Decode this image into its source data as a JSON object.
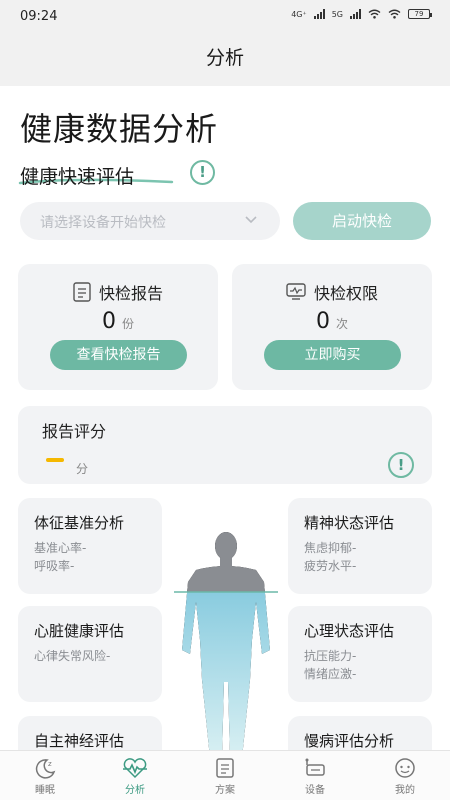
{
  "status_bar": {
    "time": "09:24",
    "net1": "4G⁺",
    "net2": "5G",
    "battery": "79"
  },
  "header": {
    "title": "分析"
  },
  "page": {
    "title": "健康数据分析"
  },
  "quick_eval": {
    "title": "健康快速评估",
    "select_placeholder": "请选择设备开始快检",
    "start_label": "启动快检"
  },
  "cards": {
    "report": {
      "title": "快检报告",
      "value": "0",
      "unit": "份",
      "button": "查看快检报告"
    },
    "permission": {
      "title": "快检权限",
      "value": "0",
      "unit": "次",
      "button": "立即购买"
    }
  },
  "score": {
    "title": "报告评分",
    "unit": "分",
    "value": ""
  },
  "evaluations": [
    {
      "title": "体征基准分析",
      "lines": [
        "基准心率-",
        "呼吸率-"
      ]
    },
    {
      "title": "精神状态评估",
      "lines": [
        "焦虑抑郁-",
        "疲劳水平-"
      ]
    },
    {
      "title": "心脏健康评估",
      "lines": [
        "心律失常风险-"
      ]
    },
    {
      "title": "心理状态评估",
      "lines": [
        "抗压能力-",
        "情绪应激-"
      ]
    },
    {
      "title": "自主神经评估",
      "lines": []
    },
    {
      "title": "慢病评估分析",
      "lines": []
    }
  ],
  "tabbar": [
    {
      "label": "睡眠",
      "icon": "moon-icon",
      "active": false
    },
    {
      "label": "分析",
      "icon": "heartbeat-icon",
      "active": true
    },
    {
      "label": "方案",
      "icon": "document-icon",
      "active": false
    },
    {
      "label": "设备",
      "icon": "device-icon",
      "active": false
    },
    {
      "label": "我的",
      "icon": "profile-icon",
      "active": false
    }
  ],
  "colors": {
    "accent": "#6db8a3",
    "accent_light": "#a6d4cb",
    "score_dash": "#f5b800",
    "body": "#8fd0de"
  }
}
